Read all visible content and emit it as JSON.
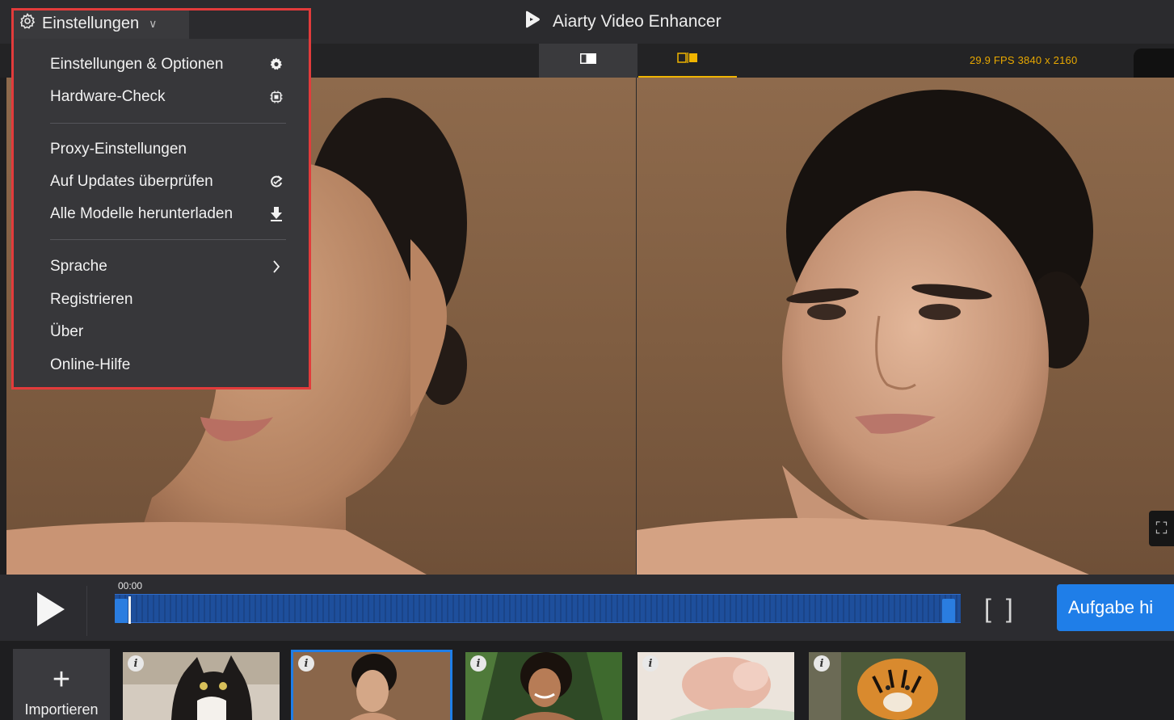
{
  "window": {
    "app_title": "Aiarty Video Enhancer",
    "settings_menu_label": "Einstellungen"
  },
  "viewbar": {
    "video_info": "29.9 FPS  3840 x 2160"
  },
  "settings_menu": {
    "items": [
      {
        "label": "Einstellungen & Optionen",
        "icon": "gear-icon"
      },
      {
        "label": "Hardware-Check",
        "icon": "chip-icon"
      },
      {
        "label": "Proxy-Einstellungen",
        "icon": ""
      },
      {
        "label": "Auf Updates überprüfen",
        "icon": "refresh-icon"
      },
      {
        "label": "Alle Modelle herunterladen",
        "icon": "download-icon"
      },
      {
        "label": "Sprache",
        "icon": "chevron-right-icon"
      },
      {
        "label": "Registrieren",
        "icon": ""
      },
      {
        "label": "Über",
        "icon": ""
      },
      {
        "label": "Online-Hilfe",
        "icon": ""
      }
    ]
  },
  "timeline": {
    "timecode": "00:00",
    "primary_button": "Aufgabe hi"
  },
  "thumbnails": {
    "import_label": "Importieren",
    "items": [
      {
        "subject": "cat",
        "selected": false
      },
      {
        "subject": "woman-portrait",
        "selected": true
      },
      {
        "subject": "woman-smiling",
        "selected": false
      },
      {
        "subject": "newborn",
        "selected": false
      },
      {
        "subject": "tiger",
        "selected": false
      }
    ],
    "info_badge": "i"
  },
  "colors": {
    "accent_blue": "#1f7ee8",
    "accent_gold": "#f0b400",
    "highlight_red": "#e23b3b"
  }
}
